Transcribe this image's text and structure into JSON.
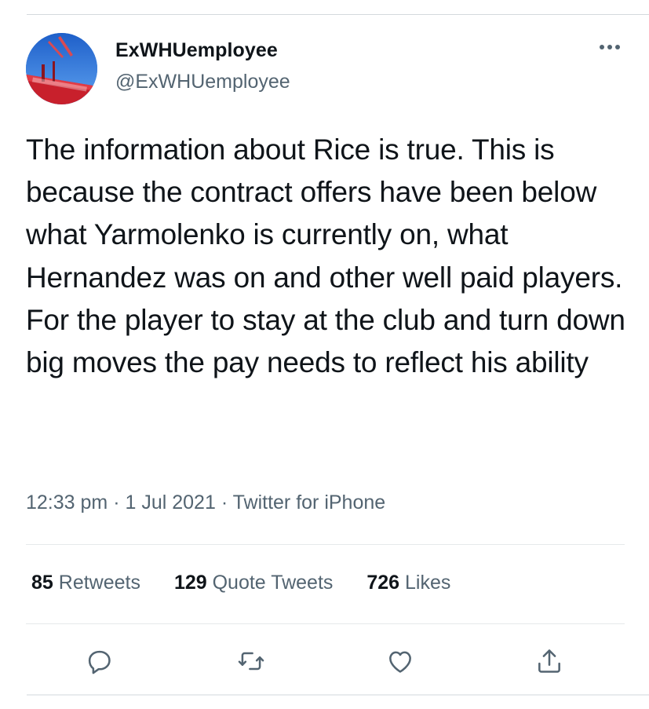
{
  "user": {
    "display_name": "ExWHUemployee",
    "handle": "@ExWHUemployee",
    "avatar_icon": "avatar-stadium-photo"
  },
  "tweet": {
    "text": "The information about Rice is true. This is because the contract offers have been below what Yarmolenko is currently on, what Hernandez was on and other well paid players. For the player to stay at the club and turn down big moves the pay needs to reflect his ability"
  },
  "meta": {
    "time": "12:33 pm",
    "separator": "·",
    "date": "1 Jul 2021",
    "source": "Twitter for iPhone"
  },
  "stats": {
    "retweets_count": "85",
    "retweets_label": "Retweets",
    "quotes_count": "129",
    "quotes_label": "Quote Tweets",
    "likes_count": "726",
    "likes_label": "Likes"
  },
  "actions": {
    "reply_icon": "reply-icon",
    "retweet_icon": "retweet-icon",
    "like_icon": "heart-icon",
    "share_icon": "share-icon",
    "more_icon": "more-icon"
  },
  "colors": {
    "text_primary": "#0f1419",
    "text_secondary": "#536471",
    "divider": "#e6e9eb"
  }
}
